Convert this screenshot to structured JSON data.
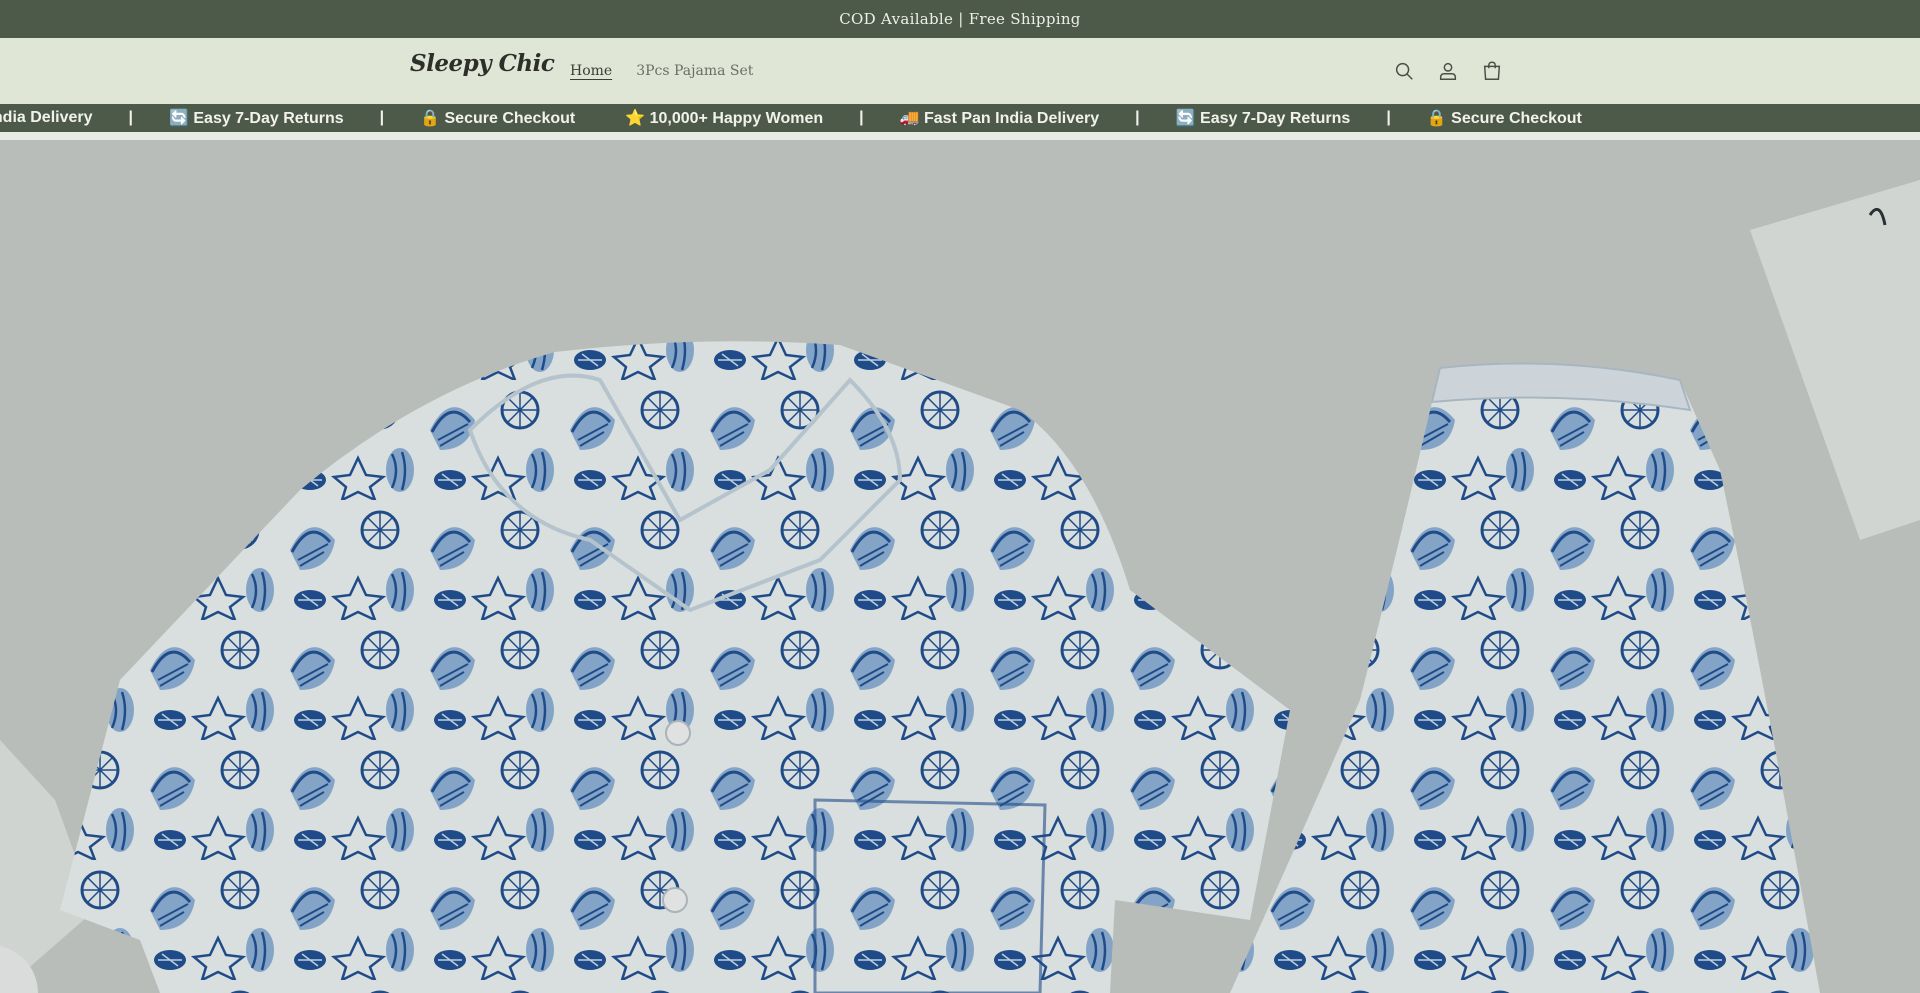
{
  "announcement": {
    "text": "COD Available | Free Shipping"
  },
  "header": {
    "logo": "Sleepy Chic",
    "nav": [
      {
        "label": "Home",
        "active": true
      },
      {
        "label": "3Pcs Pajama Set",
        "active": false
      }
    ],
    "icons": [
      "search-icon",
      "account-icon",
      "cart-icon"
    ]
  },
  "marquee": {
    "items": [
      "st Pan India Delivery",
      "🔄 Easy 7-Day Returns",
      "🔒 Secure Checkout",
      "⭐ 10,000+ Happy Women",
      "🚚 Fast Pan India Delivery",
      "🔄 Easy 7-Day Returns",
      "🔒 Secure Checkout"
    ],
    "separator": "|"
  },
  "colors": {
    "bar": "#4d5a4a",
    "header_bg": "#dfe6d6",
    "print_dark": "#1f4f93",
    "print_light": "#8fb2d8"
  }
}
